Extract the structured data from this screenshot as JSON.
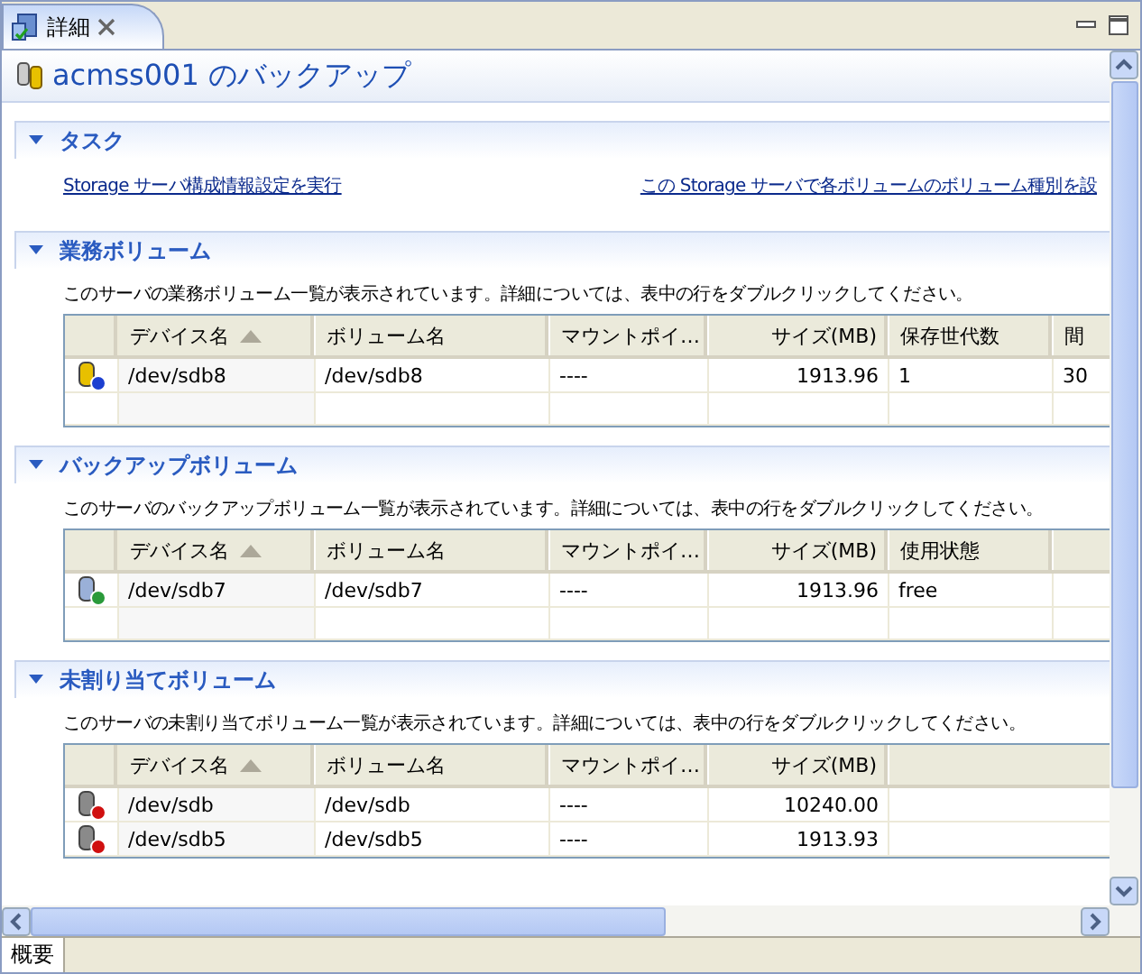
{
  "view_tab": {
    "label": "詳細",
    "selected": true
  },
  "page_title": "acmss001 のバックアップ",
  "task_section": {
    "title": "タスク",
    "expanded": true,
    "links": [
      "Storage サーバ構成情報設定を実行",
      "この Storage サーバで各ボリュームのボリューム種別を設"
    ]
  },
  "sections": [
    {
      "title": "業務ボリューム",
      "expanded": true,
      "description": "このサーバの業務ボリューム一覧が表示されています。詳細については、表中の行をダブルクリックしてください。",
      "columns": [
        {
          "label": "デバイス名",
          "sorted": true,
          "numeric": false
        },
        {
          "label": "ボリューム名",
          "sorted": false,
          "numeric": false
        },
        {
          "label": "マウントポイ…",
          "sorted": false,
          "numeric": false
        },
        {
          "label": "サイズ(MB)",
          "sorted": false,
          "numeric": true
        },
        {
          "label": "保存世代数",
          "sorted": false,
          "numeric": false
        },
        {
          "label": "間",
          "sorted": false,
          "numeric": false
        }
      ],
      "rows": [
        {
          "kind": "business",
          "cells": [
            "/dev/sdb8",
            "/dev/sdb8",
            "----",
            "1913.96",
            "1",
            "30"
          ]
        }
      ]
    },
    {
      "title": "バックアップボリューム",
      "expanded": true,
      "description": "このサーバのバックアップボリューム一覧が表示されています。詳細については、表中の行をダブルクリックしてください。",
      "columns": [
        {
          "label": "デバイス名",
          "sorted": true,
          "numeric": false
        },
        {
          "label": "ボリューム名",
          "sorted": false,
          "numeric": false
        },
        {
          "label": "マウントポイ…",
          "sorted": false,
          "numeric": false
        },
        {
          "label": "サイズ(MB)",
          "sorted": false,
          "numeric": true
        },
        {
          "label": "使用状態",
          "sorted": false,
          "numeric": false
        }
      ],
      "rows": [
        {
          "kind": "backup",
          "cells": [
            "/dev/sdb7",
            "/dev/sdb7",
            "----",
            "1913.96",
            "free"
          ]
        }
      ]
    },
    {
      "title": "未割り当てボリューム",
      "expanded": true,
      "description": "このサーバの未割り当てボリューム一覧が表示されています。詳細については、表中の行をダブルクリックしてください。",
      "columns": [
        {
          "label": "デバイス名",
          "sorted": true,
          "numeric": false
        },
        {
          "label": "ボリューム名",
          "sorted": false,
          "numeric": false
        },
        {
          "label": "マウントポイ…",
          "sorted": false,
          "numeric": false
        },
        {
          "label": "サイズ(MB)",
          "sorted": false,
          "numeric": true
        }
      ],
      "rows": [
        {
          "kind": "unassigned",
          "cells": [
            "/dev/sdb",
            "/dev/sdb",
            "----",
            "10240.00"
          ]
        },
        {
          "kind": "unassigned",
          "cells": [
            "/dev/sdb5",
            "/dev/sdb5",
            "----",
            "1913.93"
          ]
        }
      ]
    }
  ],
  "bottom_tabs": [
    {
      "label": "概要",
      "selected": true
    }
  ]
}
